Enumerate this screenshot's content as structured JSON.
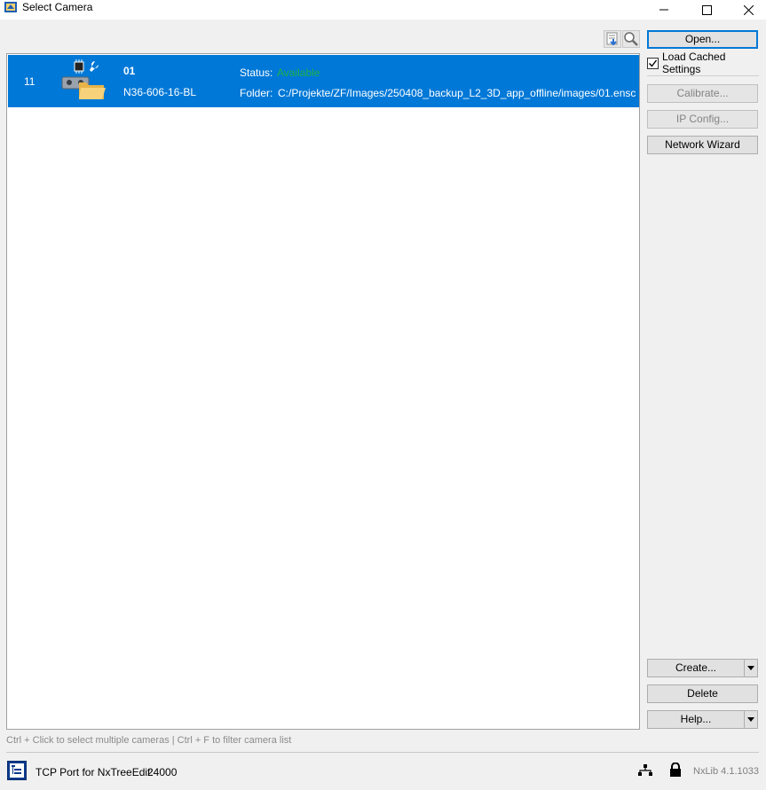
{
  "window": {
    "title": "Select Camera"
  },
  "toolbar": {
    "icons": [
      "export-list-icon",
      "search-icon"
    ]
  },
  "camera_list": {
    "rows": [
      {
        "index": "11",
        "serial": "01",
        "model": "N36-606-16-BL",
        "status_label": "Status:",
        "status_value": "Available",
        "folder_label": "Folder:",
        "folder_value": "C:/Projekte/ZF/Images/250408_backup_L2_3D_app_offline/images/01.ensc",
        "icon": "file-camera-icon",
        "selected": true
      }
    ]
  },
  "side_panel": {
    "open_label": "Open...",
    "load_cached_label": "Load Cached Settings",
    "load_cached_checked": true,
    "calibrate_label": "Calibrate...",
    "ip_config_label": "IP Config...",
    "network_wizard_label": "Network Wizard",
    "create_label": "Create...",
    "delete_label": "Delete",
    "help_label": "Help..."
  },
  "hint_text": "Ctrl + Click to select multiple cameras | Ctrl + F to filter camera list",
  "statusbar": {
    "tcp_label": "TCP Port for NxTreeEdit:",
    "tcp_port": "24000",
    "version": "NxLib 4.1.1033"
  },
  "colors": {
    "selection": "#0078d7",
    "status_available": "#1fb14a",
    "disabled_text": "#838383"
  }
}
